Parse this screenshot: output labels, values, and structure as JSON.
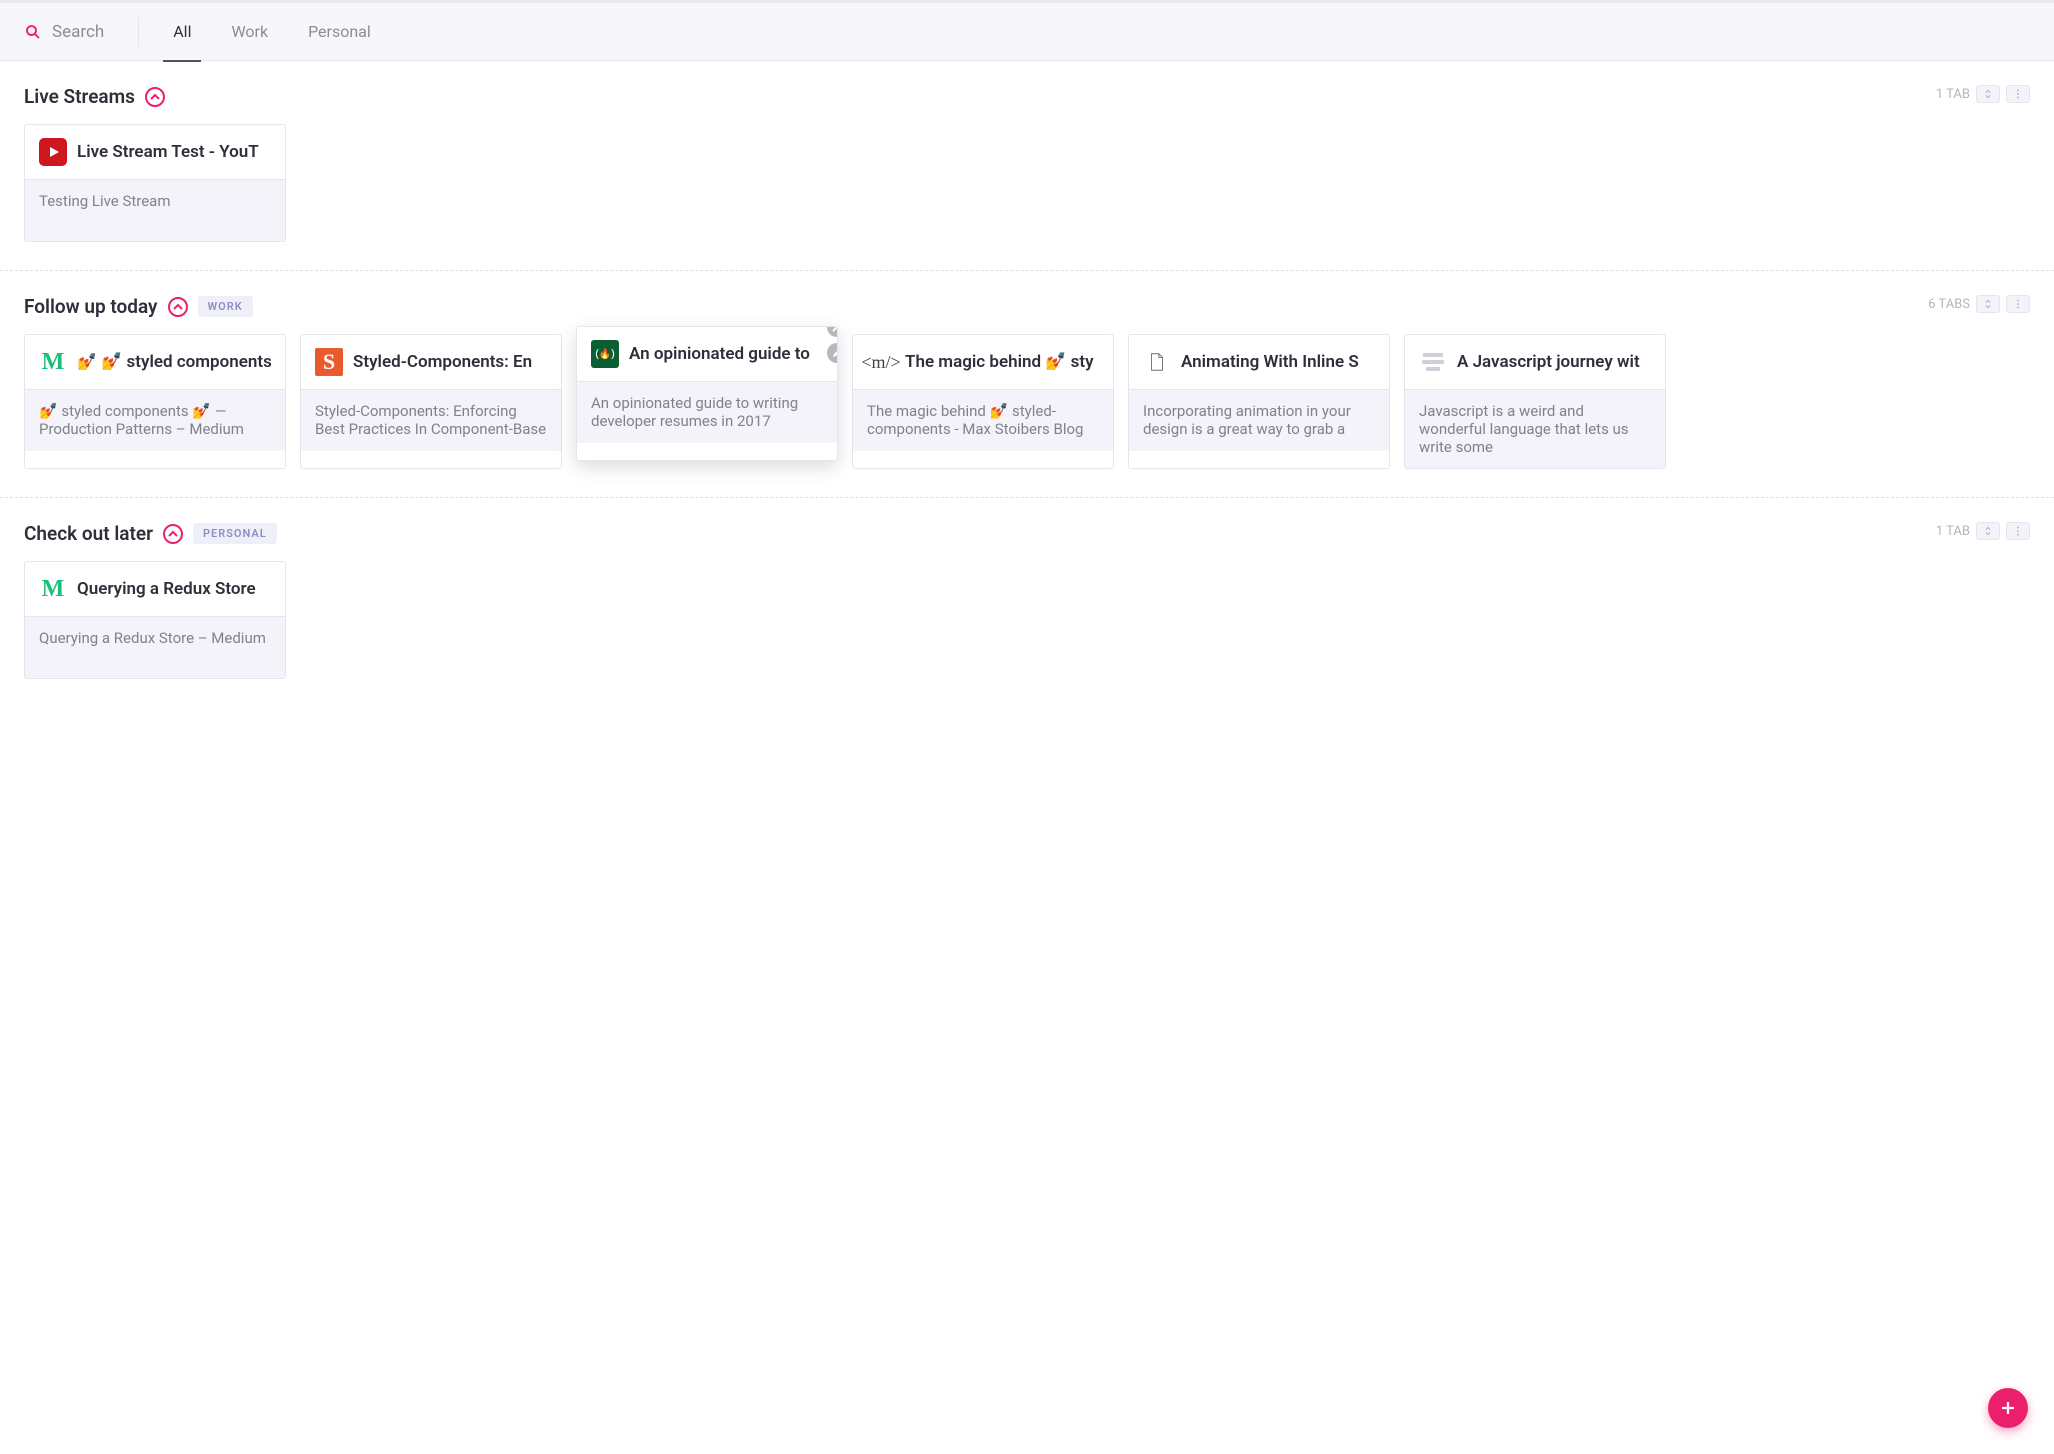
{
  "topbar": {
    "search_label": "Search",
    "filters": [
      {
        "id": "all",
        "label": "All",
        "active": true
      },
      {
        "id": "work",
        "label": "Work",
        "active": false
      },
      {
        "id": "personal",
        "label": "Personal",
        "active": false
      }
    ]
  },
  "sections": [
    {
      "id": "live",
      "title": "Live Streams",
      "tag": null,
      "tab_count": "1 TAB",
      "cards": [
        {
          "icon": "youtube",
          "title": "Live Stream Test - YouT",
          "sub": "Testing Live Stream",
          "active": false
        }
      ]
    },
    {
      "id": "followup",
      "title": "Follow up today",
      "tag": "WORK",
      "tab_count": "6 TABS",
      "cards": [
        {
          "icon": "medium",
          "title": "💅 styled components",
          "sub": "💅 styled components 💅 — Production Patterns – Medium",
          "active": false,
          "prefix_emoji": "💅"
        },
        {
          "icon": "smashing",
          "title": "Styled-Components: En",
          "sub": "Styled-Components: Enforcing Best Practices In Component-Base",
          "active": false
        },
        {
          "icon": "fcc",
          "title": "An opinionated guide to",
          "sub": "An opinionated guide to writing developer resumes in 2017",
          "active": true
        },
        {
          "icon": "mx",
          "title": "The magic behind 💅 sty",
          "sub": "The magic behind 💅 styled-components - Max Stoibers Blog",
          "active": false
        },
        {
          "icon": "file",
          "title": "Animating With Inline S",
          "sub": "Incorporating animation in your design is a great way to grab a",
          "active": false
        },
        {
          "icon": "lines",
          "title": "A Javascript journey wit",
          "sub": "Javascript is a weird and wonderful language that lets us write some",
          "active": false
        }
      ]
    },
    {
      "id": "later",
      "title": "Check out later",
      "tag": "PERSONAL",
      "tab_count": "1 TAB",
      "cards": [
        {
          "icon": "medium",
          "title": "Querying a Redux Store",
          "sub": "Querying a Redux Store – Medium",
          "active": false
        }
      ]
    }
  ],
  "colors": {
    "accent": "#ec1f6d"
  }
}
